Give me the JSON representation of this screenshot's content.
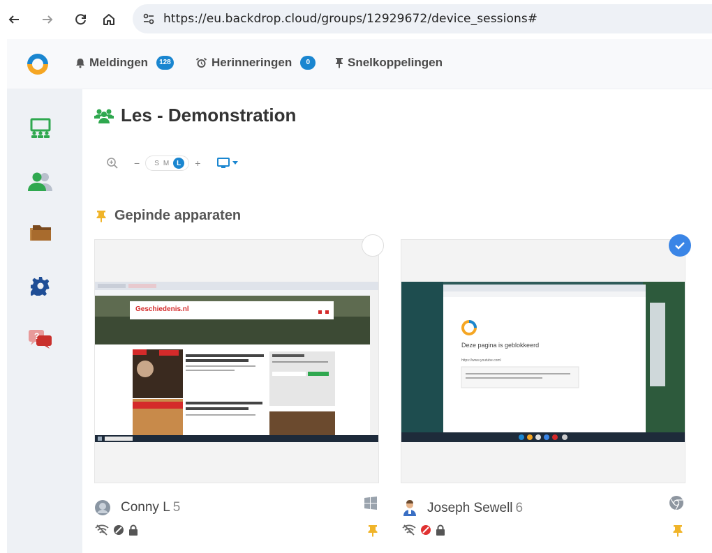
{
  "browser": {
    "url": "https://eu.backdrop.cloud/groups/12929672/device_sessions#"
  },
  "header": {
    "notifications_label": "Meldingen",
    "notifications_count": "128",
    "reminders_label": "Herinneringen",
    "reminders_count": "0",
    "shortcuts_label": "Snelkoppelingen"
  },
  "page": {
    "title": "Les - Demonstration",
    "size_options": [
      "S",
      "M",
      "L"
    ],
    "size_selected": "L",
    "zoom_minus": "−",
    "zoom_plus": "+"
  },
  "section": {
    "title": "Gepinde apparaten"
  },
  "devices": [
    {
      "name": "Conny L",
      "count": "5",
      "os": "windows",
      "selected": false,
      "screen_site": "Geschiedenis.nl"
    },
    {
      "name": "Joseph Sewell",
      "count": "6",
      "os": "chrome",
      "selected": true,
      "screen_blocked_text": "Deze pagina is geblokkeerd",
      "screen_blocked_url": "https://www.youtube.com/"
    }
  ],
  "colors": {
    "accent": "#1a86d0",
    "green": "#2fa84f",
    "pin": "#f0b429",
    "check": "#3a85e6"
  }
}
